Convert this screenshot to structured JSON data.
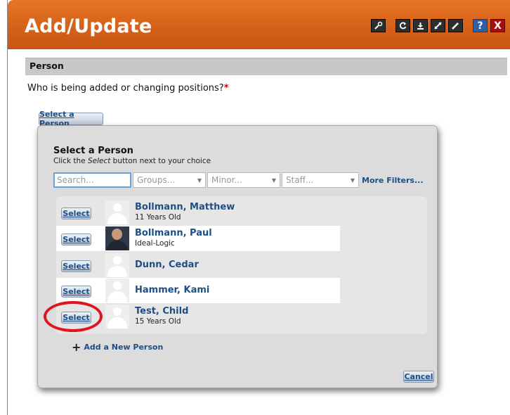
{
  "window": {
    "title": "Add/Update",
    "toolbar_icons": [
      "wrench-icon",
      "refresh-icon",
      "download-icon",
      "expand-icon",
      "edit-icon"
    ],
    "help_label": "?",
    "close_label": "X"
  },
  "section": {
    "title": "Person"
  },
  "question": {
    "text": "Who is being added or changing positions?",
    "required_mark": "*"
  },
  "select_person_button": "Select a Person",
  "dialog": {
    "title": "Select a Person",
    "subtitle_pre": "Click the ",
    "subtitle_em": "Select",
    "subtitle_post": " button next to your choice",
    "search_placeholder": "Search...",
    "filters": [
      "Groups...",
      "Minor...",
      "Staff..."
    ],
    "more_filters": "More Filters...",
    "select_label": "Select",
    "people": [
      {
        "name": "Bollmann, Matthew",
        "detail": "11 Years Old",
        "photo": "placeholder"
      },
      {
        "name": "Bollmann, Paul",
        "detail": "Ideal-Logic",
        "photo": "real"
      },
      {
        "name": "Dunn, Cedar",
        "detail": "",
        "photo": "placeholder"
      },
      {
        "name": "Hammer, Kami",
        "detail": "",
        "photo": "placeholder"
      },
      {
        "name": "Test, Child",
        "detail": "15 Years Old",
        "photo": "placeholder"
      }
    ],
    "add_new": "Add a New Person",
    "cancel": "Cancel"
  },
  "colors": {
    "title_bar": "#d9641b",
    "link": "#1d4f86",
    "highlight_circle": "#e0141e",
    "required": "#cc0000"
  }
}
